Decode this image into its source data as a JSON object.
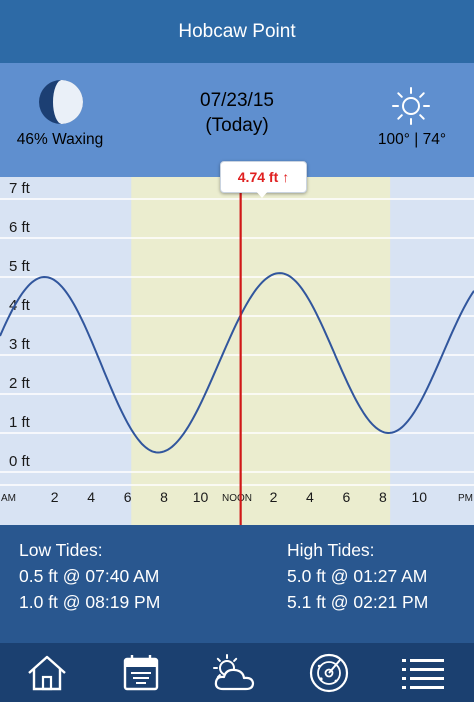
{
  "title": "Hobcaw Point",
  "moon": {
    "phase_label": "46% Waxing",
    "icon": "moon-phase-icon"
  },
  "date": {
    "value": "07/23/15",
    "relative": "(Today)"
  },
  "weather": {
    "icon": "sun-icon",
    "temps": "100° | 74°"
  },
  "current_tide": {
    "label": "4.74 ft",
    "arrow": "↑"
  },
  "chart_data": {
    "type": "line",
    "title": "",
    "x_unit": "hour of day",
    "xlim": [
      -1,
      25
    ],
    "ylim": [
      -0.6,
      7.6
    ],
    "y_ticks": [
      0,
      1,
      2,
      3,
      4,
      5,
      6,
      7
    ],
    "y_tick_labels": [
      "0 ft",
      "1 ft",
      "2 ft",
      "3 ft",
      "4 ft",
      "5 ft",
      "6 ft",
      "7 ft"
    ],
    "x_ticks": [
      0,
      2,
      4,
      6,
      8,
      10,
      12,
      14,
      16,
      18,
      20,
      22,
      24
    ],
    "x_tick_labels": [
      "AM",
      "2",
      "4",
      "6",
      "8",
      "10",
      "NOON",
      "2",
      "4",
      "6",
      "8",
      "10",
      "PM"
    ],
    "daylight_range": [
      6.2,
      20.4
    ],
    "current_time": 12.2,
    "tide_points": [
      {
        "x": 1.45,
        "y": 5.0,
        "kind": "high"
      },
      {
        "x": 7.67,
        "y": 0.5,
        "kind": "low"
      },
      {
        "x": 14.35,
        "y": 5.1,
        "kind": "high"
      },
      {
        "x": 20.32,
        "y": 1.0,
        "kind": "low"
      }
    ],
    "colors": {
      "line": "#31569d",
      "now": "#d01818",
      "daylight": "#ebedcf",
      "night": "#d8e3f3",
      "grid": "#ffffff"
    }
  },
  "low_tides": {
    "heading": "Low Tides:",
    "entries": [
      "0.5 ft @ 07:40 AM",
      "1.0 ft @ 08:19 PM"
    ]
  },
  "high_tides": {
    "heading": "High Tides:",
    "entries": [
      "5.0 ft @ 01:27 AM",
      "5.1 ft @ 02:21 PM"
    ]
  },
  "nav": {
    "items": [
      "home-icon",
      "calendar-icon",
      "weather-cloud-icon",
      "radar-icon",
      "menu-list-icon"
    ]
  },
  "colors": {
    "titlebar": "#2d6aa6",
    "header": "#5f8fcf",
    "tides_panel": "#29578f",
    "nav": "#1b4070"
  }
}
